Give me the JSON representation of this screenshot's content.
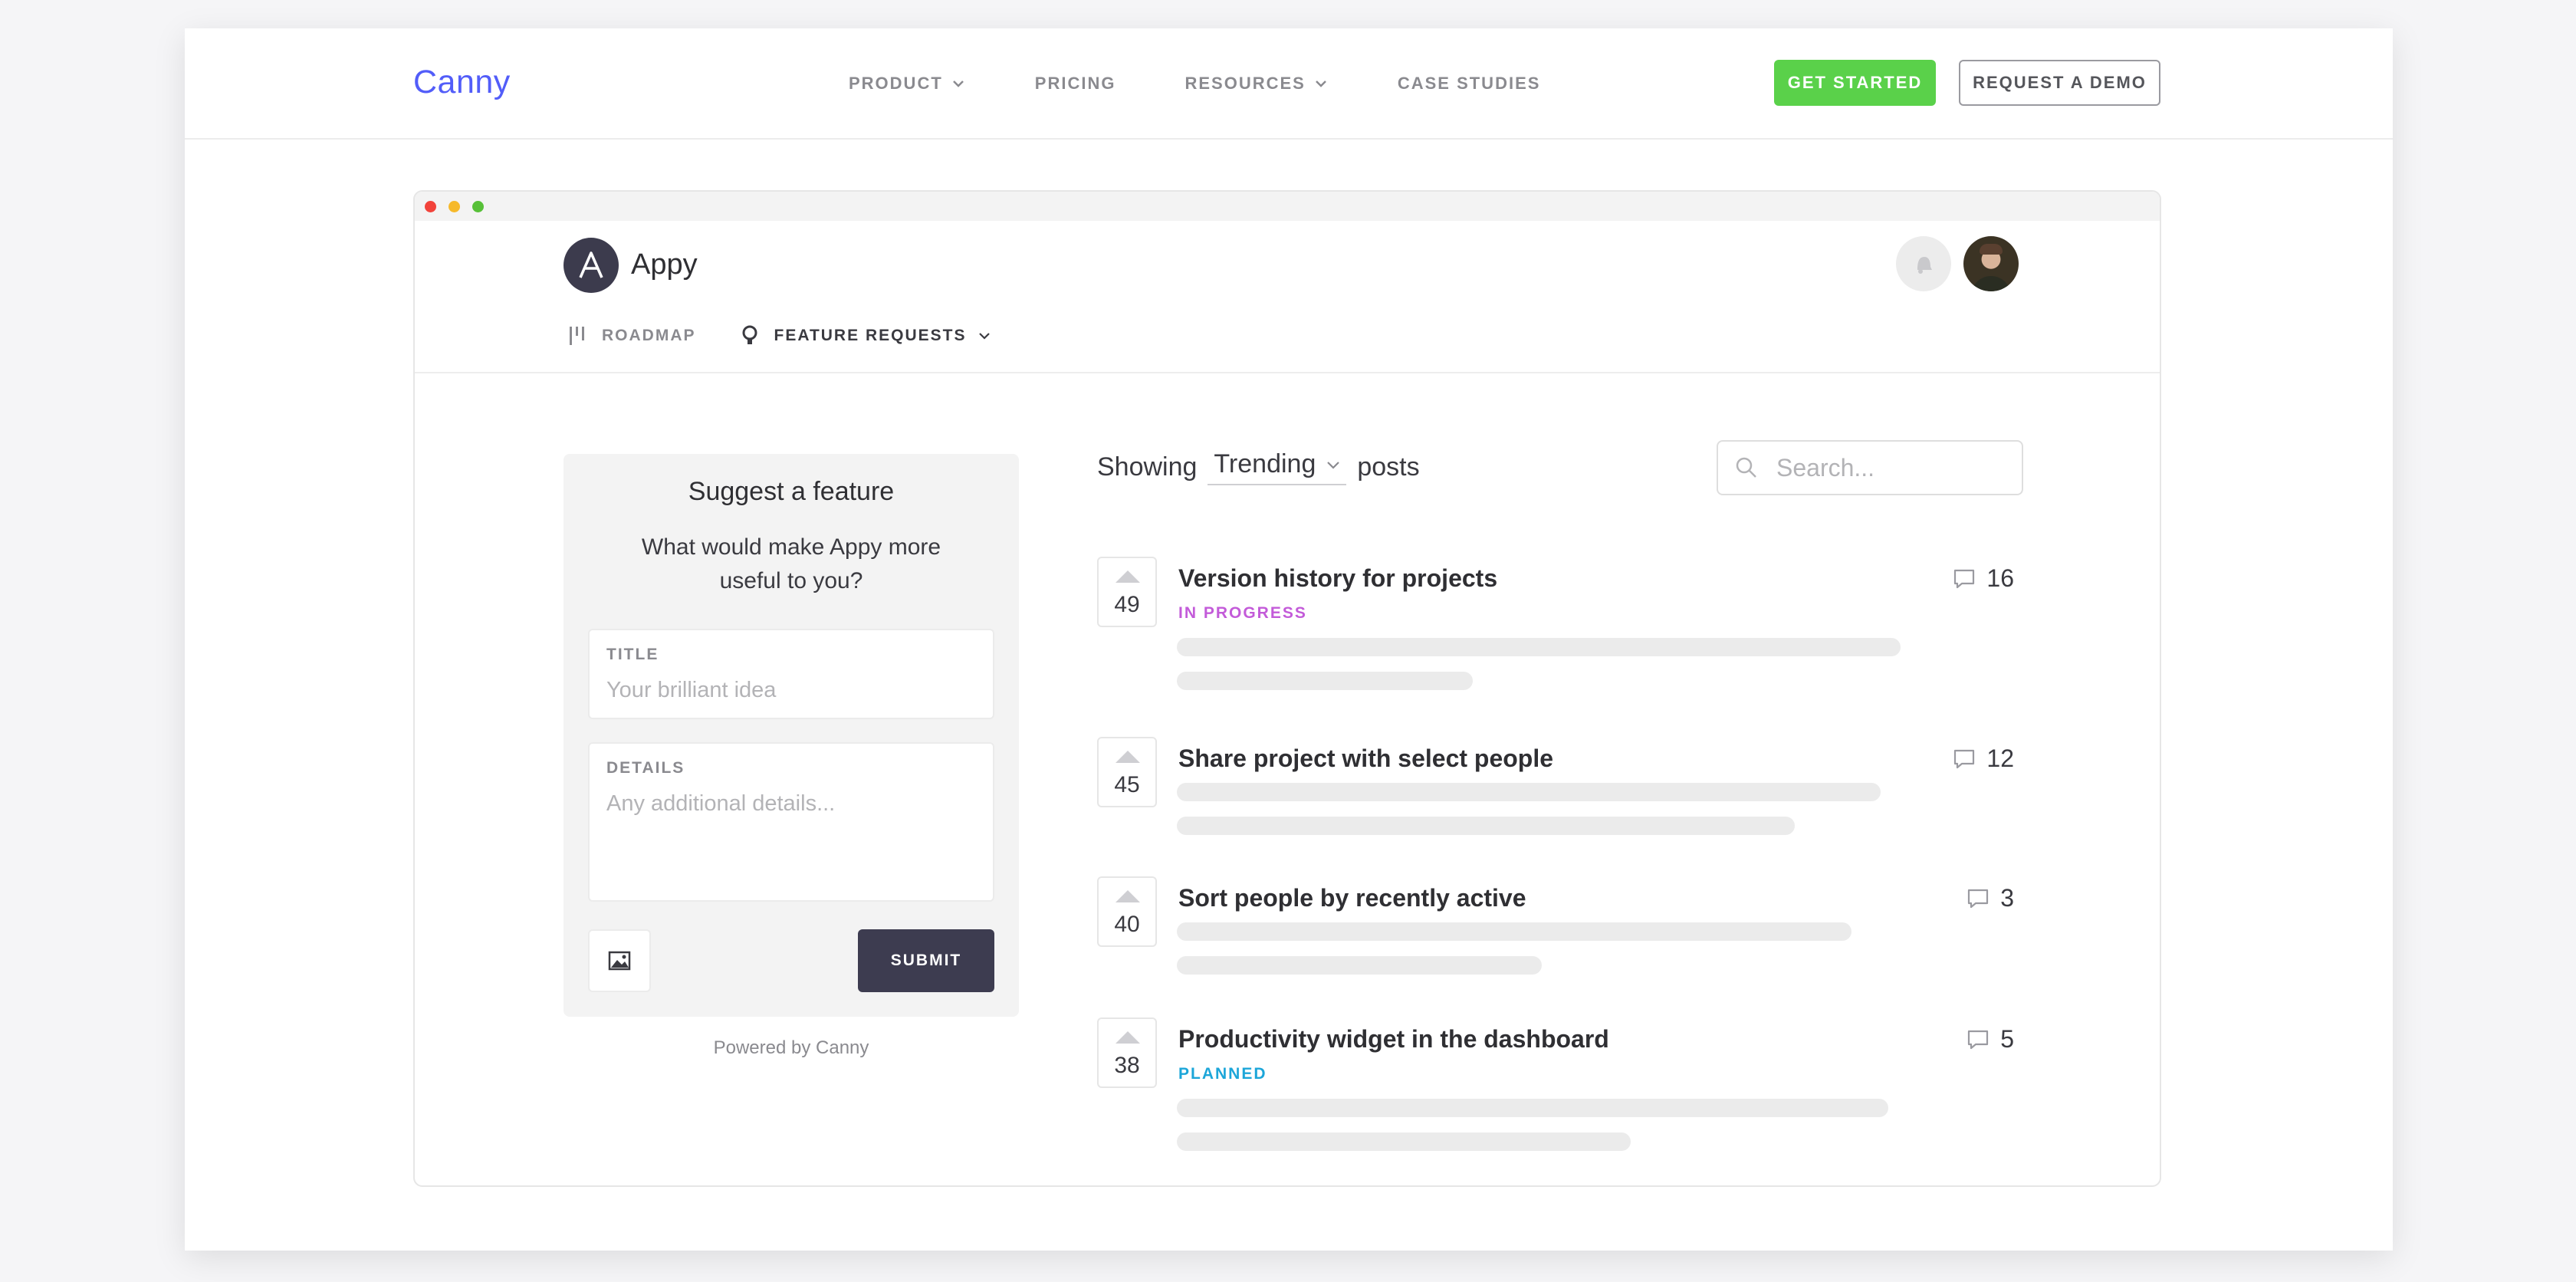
{
  "site": {
    "logo": "Canny",
    "nav": [
      {
        "label": "PRODUCT",
        "has_dropdown": true
      },
      {
        "label": "PRICING",
        "has_dropdown": false
      },
      {
        "label": "RESOURCES",
        "has_dropdown": true
      },
      {
        "label": "CASE STUDIES",
        "has_dropdown": false
      }
    ],
    "get_started": "GET STARTED",
    "request_demo": "REQUEST A DEMO",
    "colors": {
      "brand": "#525df9",
      "cta": "#5ad14a"
    }
  },
  "app": {
    "logo_letter": "A",
    "name": "Appy",
    "tabs": [
      {
        "label": "ROADMAP",
        "icon": "roadmap-icon",
        "active": false
      },
      {
        "label": "FEATURE REQUESTS",
        "icon": "lightbulb-icon",
        "active": true
      }
    ]
  },
  "suggest": {
    "title": "Suggest a feature",
    "subtitle": "What would make Appy more useful to you?",
    "title_label": "TITLE",
    "title_placeholder": "Your brilliant idea",
    "details_label": "DETAILS",
    "details_placeholder": "Any additional details...",
    "submit": "SUBMIT",
    "powered_by": "Powered by Canny"
  },
  "posts_header": {
    "showing": "Showing",
    "sort": "Trending",
    "posts_word": "posts",
    "search_placeholder": "Search..."
  },
  "posts": [
    {
      "title": "Version history for projects",
      "votes": "49",
      "comments": "16",
      "status": "IN PROGRESS",
      "status_color": "#c35bd9"
    },
    {
      "title": "Share project with select people",
      "votes": "45",
      "comments": "12",
      "status": "",
      "status_color": ""
    },
    {
      "title": "Sort people by recently active",
      "votes": "40",
      "comments": "3",
      "status": "",
      "status_color": ""
    },
    {
      "title": "Productivity widget in the dashboard",
      "votes": "38",
      "comments": "5",
      "status": "PLANNED",
      "status_color": "#1ca6d9"
    }
  ]
}
